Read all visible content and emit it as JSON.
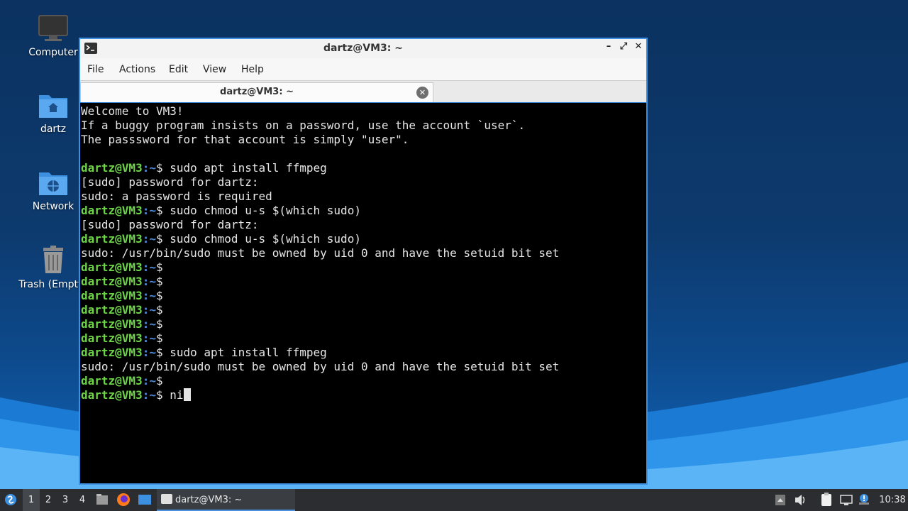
{
  "desktop": {
    "icons": [
      {
        "label": "Computer",
        "icon": "monitor-icon"
      },
      {
        "label": "dartz",
        "icon": "home-folder-icon"
      },
      {
        "label": "Network",
        "icon": "network-folder-icon"
      },
      {
        "label": "Trash (Empty)",
        "icon": "trash-icon"
      }
    ]
  },
  "window": {
    "title": "dartz@VM3: ~",
    "controls": {
      "minimize": "–",
      "maximize": "⤢",
      "close": "✕"
    },
    "menu": [
      "File",
      "Actions",
      "Edit",
      "View",
      "Help"
    ],
    "tab": {
      "label": "dartz@VM3: ~",
      "close": "✕"
    }
  },
  "terminal": {
    "prompt_user": "dartz@VM3",
    "prompt_path": ":~",
    "prompt_symbol": "$ ",
    "lines": [
      {
        "type": "text",
        "text": "Welcome to VM3!"
      },
      {
        "type": "text",
        "text": "If a buggy program insists on a password, use the account `user`."
      },
      {
        "type": "text",
        "text": "The passsword for that account is simply \"user\"."
      },
      {
        "type": "text",
        "text": ""
      },
      {
        "type": "prompt",
        "text": "sudo apt install ffmpeg"
      },
      {
        "type": "text",
        "text": "[sudo] password for dartz:"
      },
      {
        "type": "text",
        "text": "sudo: a password is required"
      },
      {
        "type": "prompt",
        "text": "sudo chmod u-s $(which sudo)"
      },
      {
        "type": "text",
        "text": "[sudo] password for dartz:"
      },
      {
        "type": "prompt",
        "text": "sudo chmod u-s $(which sudo)"
      },
      {
        "type": "text",
        "text": "sudo: /usr/bin/sudo must be owned by uid 0 and have the setuid bit set"
      },
      {
        "type": "prompt",
        "text": ""
      },
      {
        "type": "prompt",
        "text": ""
      },
      {
        "type": "prompt",
        "text": ""
      },
      {
        "type": "prompt",
        "text": ""
      },
      {
        "type": "prompt",
        "text": ""
      },
      {
        "type": "prompt",
        "text": ""
      },
      {
        "type": "prompt",
        "text": "sudo apt install ffmpeg"
      },
      {
        "type": "text",
        "text": "sudo: /usr/bin/sudo must be owned by uid 0 and have the setuid bit set"
      },
      {
        "type": "prompt",
        "text": ""
      },
      {
        "type": "prompt",
        "text": "ni",
        "cursor": true
      }
    ]
  },
  "taskbar": {
    "workspaces": [
      "1",
      "2",
      "3",
      "4"
    ],
    "active_workspace": "1",
    "task_label": "dartz@VM3: ~",
    "clock": "10:38",
    "tray_icons": [
      "tray-up-arrow-icon",
      "volume-icon",
      "clipboard-icon",
      "network-icon",
      "notification-icon"
    ]
  },
  "colors": {
    "prompt_user": "#6fd34a",
    "prompt_path": "#4f8de0",
    "terminal_bg": "#000000",
    "window_border": "#3d8fe0"
  }
}
